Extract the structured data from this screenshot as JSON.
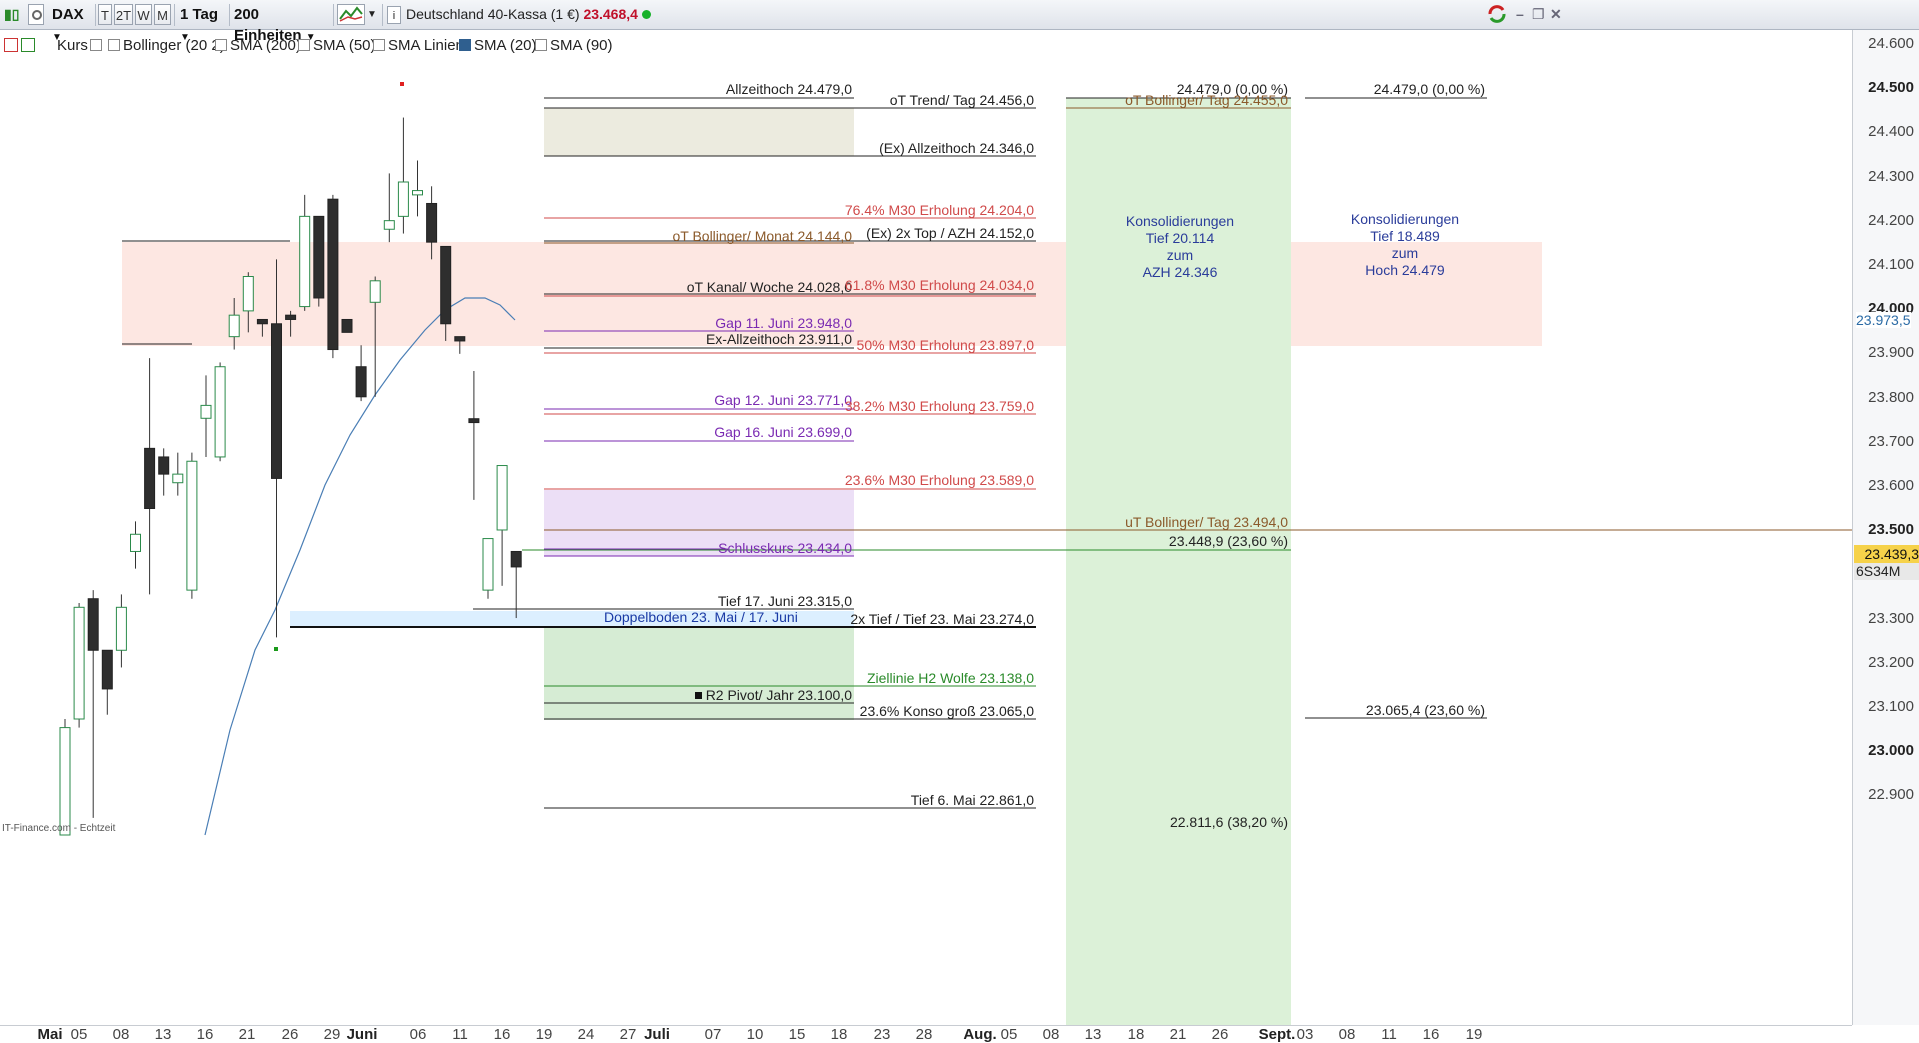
{
  "toolbar": {
    "symbol": "DAX",
    "btn_t": "T",
    "btn_2t": "2T",
    "btn_w": "W",
    "btn_m": "M",
    "period": "1 Tag",
    "units": "200 Einheiten",
    "instrument": "Deutschland 40-Kassa (1 €)",
    "price": "23.468,4"
  },
  "layers": {
    "kurs": "Kurs",
    "bollinger": "Bollinger (20 2)",
    "sma200": "SMA (200)",
    "sma50": "SMA (50)",
    "sma_linien": "SMA Linien",
    "sma20": "SMA (20)",
    "sma90": "SMA (90)"
  },
  "y_ticks": [
    "24.600",
    "24.500",
    "24.400",
    "24.300",
    "24.200",
    "24.100",
    "24.000",
    "23.900",
    "23.800",
    "23.700",
    "23.600",
    "23.500",
    "23.400",
    "23.300",
    "23.200",
    "23.100",
    "23.000",
    "22.900"
  ],
  "y_markers": {
    "current": "23.973,5",
    "last": "23.439,3",
    "timer": "6S34M"
  },
  "x_ticks": [
    "Mai",
    "05",
    "08",
    "13",
    "16",
    "21",
    "26",
    "29",
    "Juni",
    "06",
    "11",
    "16",
    "19",
    "24",
    "27",
    "Juli",
    "07",
    "10",
    "15",
    "18",
    "23",
    "28",
    "Aug.",
    "05",
    "08",
    "13",
    "18",
    "21",
    "26",
    "Sept.",
    "03",
    "08",
    "11",
    "16",
    "19"
  ],
  "annotations": {
    "allzeithoch": "Allzeithoch 24.479,0",
    "ot_trend": "oT Trend/ Tag  24.456,0",
    "ex_allzeithoch": "(Ex) Allzeithoch 24.346,0",
    "m30_764": "76.4% M30 Erholung 24.204,0",
    "ot_bollinger_monat": "oT Bollinger/ Monat 24.144,0",
    "ex_2x_top": "(Ex) 2x Top / AZH 24.152,0",
    "ot_kanal": "oT Kanal/ Woche 24.028,0",
    "m30_618": "61.8% M30 Erholung 24.034,0",
    "gap_11": "Gap 11. Juni  23.948,0",
    "ex_allzeithoch2": "Ex-Allzeithoch 23.911,0",
    "m30_50": "50% M30 Erholung 23.897,0",
    "gap_12": "Gap 12. Juni 23.771,0",
    "m30_382": "38.2% M30 Erholung 23.759,0",
    "gap_16": "Gap 16. Juni 23.699,0",
    "m30_236": "23.6% M30 Erholung 23.589,0",
    "ut_bollinger": "uT Bollinger/ Tag 23.494,0",
    "schlusskurs": "Schlusskurs 23.434,0",
    "fib_2360": "23.448,9 (23,60 %)",
    "tief17": "Tief 17. Juni  23.315,0",
    "doppelboden": "Doppelboden 23. Mai / 17. Juni",
    "tief2x": "2x Tief / Tief 23. Mai 23.274,0",
    "ziellinie": "Ziellinie H2 Wolfe 23.138,0",
    "r2_pivot": "R2 Pivot/ Jahr 23.100,0",
    "konso_236": "23.6% Konso  groß 23.065,0",
    "tief6": "Tief 6. Mai 22.861,0",
    "fib_000_a": "24.479,0 (0,00 %)",
    "ot_bollinger_tag": "oT Bollinger/ Tag 24.455,0",
    "fib_3820": "22.811,6 (38,20 %)",
    "fib_000_b": "24.479,0 (0,00 %)",
    "fib_2360_b": "23.065,4 (23,60 %)",
    "watermark": "IT-Finance.com - Echtzeit"
  },
  "konso1": [
    "Konsolidierungen",
    "Tief 20.114",
    "zum",
    "AZH 24.346"
  ],
  "konso2": [
    "Konsolidierungen",
    "Tief 18.489",
    "zum",
    "Hoch 24.479"
  ],
  "chart_data": {
    "type": "candlestick",
    "ylim": [
      22810,
      24600
    ],
    "candles": [
      {
        "o": 22810,
        "h": 23080,
        "l": 22810,
        "c": 23060
      },
      {
        "o": 23080,
        "h": 23350,
        "l": 23060,
        "c": 23340
      },
      {
        "o": 23360,
        "h": 23380,
        "l": 22850,
        "c": 23240
      },
      {
        "o": 23240,
        "h": 23230,
        "l": 23090,
        "c": 23150
      },
      {
        "o": 23240,
        "h": 23370,
        "l": 23200,
        "c": 23340
      },
      {
        "o": 23470,
        "h": 23540,
        "l": 23430,
        "c": 23510
      },
      {
        "o": 23710,
        "h": 23920,
        "l": 23370,
        "c": 23570
      },
      {
        "o": 23690,
        "h": 23710,
        "l": 23600,
        "c": 23650
      },
      {
        "o": 23630,
        "h": 23700,
        "l": 23600,
        "c": 23650
      },
      {
        "o": 23380,
        "h": 23700,
        "l": 23360,
        "c": 23680
      },
      {
        "o": 23780,
        "h": 23880,
        "l": 23690,
        "c": 23810
      },
      {
        "o": 23690,
        "h": 23910,
        "l": 23680,
        "c": 23900
      },
      {
        "o": 23970,
        "h": 24060,
        "l": 23940,
        "c": 24020
      },
      {
        "o": 24030,
        "h": 24120,
        "l": 23980,
        "c": 24110
      },
      {
        "o": 24010,
        "h": 24010,
        "l": 23970,
        "c": 24000
      },
      {
        "o": 24000,
        "h": 24150,
        "l": 23270,
        "c": 23640
      },
      {
        "o": 24020,
        "h": 24030,
        "l": 23970,
        "c": 24010
      },
      {
        "o": 24040,
        "h": 24300,
        "l": 24030,
        "c": 24250
      },
      {
        "o": 24250,
        "h": 24160,
        "l": 24040,
        "c": 24060
      },
      {
        "o": 24290,
        "h": 24300,
        "l": 23920,
        "c": 23940
      },
      {
        "o": 24010,
        "h": 24010,
        "l": 23980,
        "c": 23980
      },
      {
        "o": 23900,
        "h": 23950,
        "l": 23820,
        "c": 23830
      },
      {
        "o": 24050,
        "h": 24110,
        "l": 23830,
        "c": 24100
      },
      {
        "o": 24220,
        "h": 24350,
        "l": 24190,
        "c": 24240
      },
      {
        "o": 24250,
        "h": 24480,
        "l": 24210,
        "c": 24330
      },
      {
        "o": 24300,
        "h": 24380,
        "l": 24250,
        "c": 24310
      },
      {
        "o": 24280,
        "h": 24320,
        "l": 24150,
        "c": 24190
      },
      {
        "o": 24180,
        "h": 24160,
        "l": 23960,
        "c": 24000
      },
      {
        "o": 23970,
        "h": 23950,
        "l": 23930,
        "c": 23960
      },
      {
        "o": 23779,
        "h": 23890,
        "l": 23590,
        "c": 23770
      },
      {
        "o": 23380,
        "h": 23500,
        "l": 23360,
        "c": 23500
      },
      {
        "o": 23520,
        "h": 23600,
        "l": 23390,
        "c": 23670
      },
      {
        "o": 23470,
        "h": 23420,
        "l": 23315,
        "c": 23434
      }
    ]
  }
}
